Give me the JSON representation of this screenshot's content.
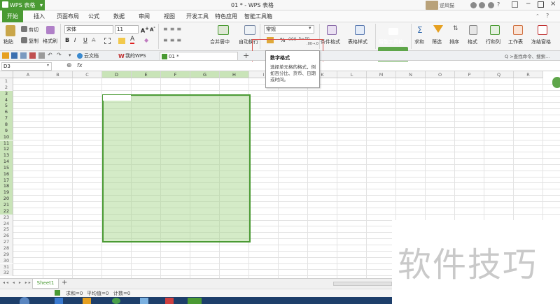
{
  "app": {
    "name": "WPS 表格",
    "window_title": "01 * - WPS 表格"
  },
  "menu": {
    "tabs": [
      "开始",
      "插入",
      "页面布局",
      "公式",
      "数据",
      "审阅",
      "视图",
      "开发工具",
      "特色应用",
      "智能工具箱"
    ],
    "active": "开始"
  },
  "ribbon": {
    "paste": "粘贴",
    "cut": "剪切",
    "copy": "复制",
    "format_painter": "格式刷",
    "font_name": "宋体",
    "font_size": "11",
    "merge_center": "合并居中",
    "wrap_text": "自动换行",
    "number_format": "常规",
    "percent": "%",
    "thousands": "000",
    "decimals_add": ".0→.00",
    "decimals_remove": ".00→.0",
    "conditional_format": "条件格式",
    "table_style": "表格样式",
    "smart_toolbox": "智能工具箱",
    "sum": "求和",
    "filter": "筛选",
    "sort": "排序",
    "format": "格式",
    "rows_cols": "行和列",
    "worksheet": "工作表",
    "freeze": "冻结窗格"
  },
  "doc_tabs": {
    "cloud": "云文档",
    "my_wps": "我的WPS",
    "current": "01 *",
    "search": "查找命令、搜索..."
  },
  "tooltip": {
    "title": "数字格式",
    "desc": "选择单元格的格式，例如百分比、货币、日期或时间。"
  },
  "formula": {
    "name_box": "D3",
    "fx": "fx",
    "value": ""
  },
  "grid": {
    "columns": [
      "A",
      "B",
      "C",
      "D",
      "E",
      "F",
      "G",
      "H",
      "I",
      "J",
      "K",
      "L",
      "M",
      "N",
      "O",
      "P",
      "Q",
      "R"
    ],
    "selected_columns": [
      "D",
      "E",
      "F",
      "G",
      "H"
    ],
    "rows": [
      "1",
      "2",
      "3",
      "4",
      "5",
      "6",
      "7",
      "8",
      "9",
      "10",
      "11",
      "12",
      "13",
      "14",
      "15",
      "16",
      "17",
      "18",
      "19",
      "20",
      "21",
      "22",
      "23",
      "24",
      "25",
      "26",
      "27",
      "28",
      "29",
      "30",
      "31",
      "32"
    ],
    "selected_rows_from": 3,
    "selected_rows_to": 22,
    "active_cell": "D3"
  },
  "sheets": {
    "tabs": [
      "Sheet1"
    ],
    "add": "+"
  },
  "status": {
    "sum": "求和=0",
    "avg": "平均值=0",
    "count": "计数=0"
  },
  "user": {
    "name": "逆风猫"
  },
  "watermark": "软件技巧",
  "colors": {
    "accent": "#4a9a33",
    "selection_fill": "#c9e4b8",
    "highlight_border": "#d9534f"
  }
}
